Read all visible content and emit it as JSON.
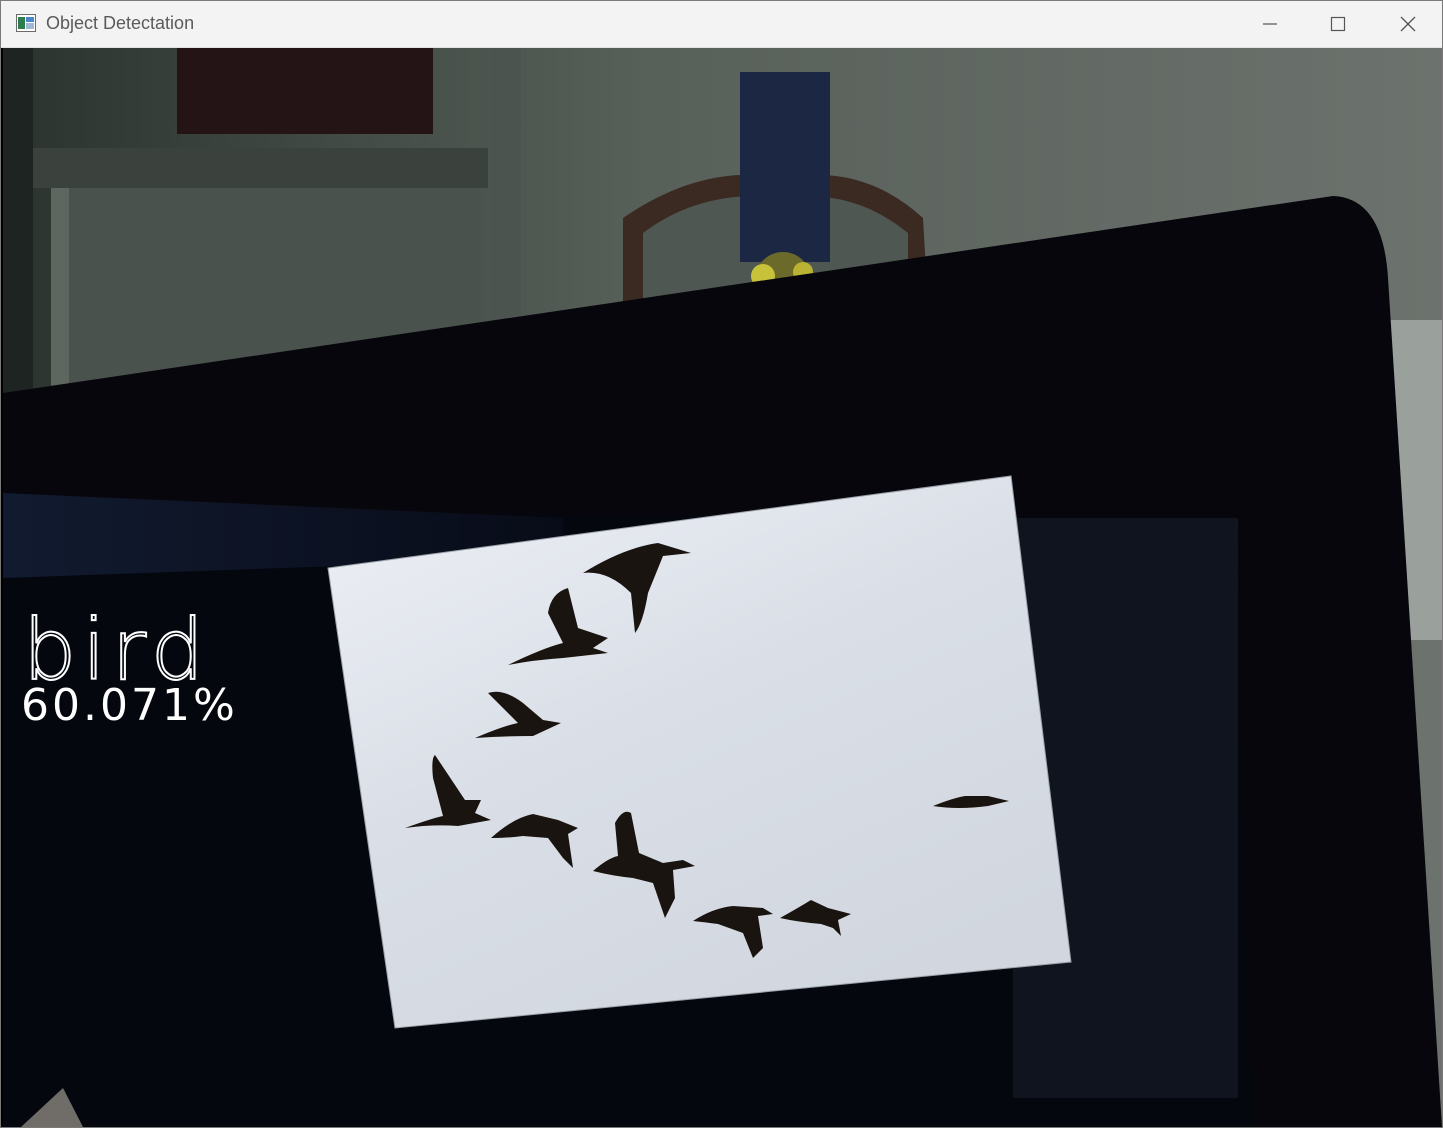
{
  "window": {
    "title": "Object Detectation",
    "icon": "app-window-icon",
    "controls": {
      "minimize_icon": "minimize-icon",
      "maximize_icon": "maximize-icon",
      "close_icon": "close-icon"
    }
  },
  "detection": {
    "label": "bird",
    "confidence": "60.071%",
    "text_color": "#ffffff"
  },
  "colors": {
    "titlebar_bg": "#f3f3f3",
    "title_text": "#5b5b5b",
    "photo_sky": "#d9dee6",
    "monitor_frame": "#07060c"
  }
}
